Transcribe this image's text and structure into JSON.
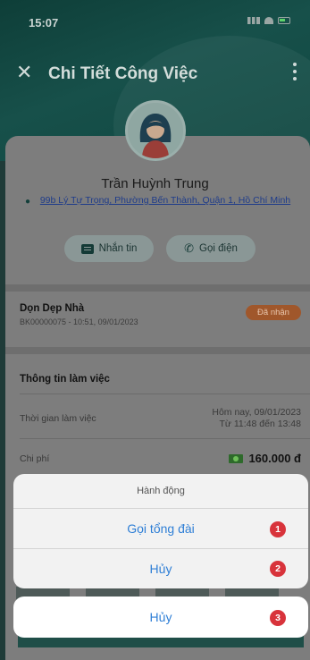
{
  "status_bar": {
    "time": "15:07"
  },
  "app_bar": {
    "title": "Chi Tiết Công Việc",
    "close_icon": "close-icon",
    "more_icon": "more-vertical-icon"
  },
  "customer": {
    "name": "Trần Huỳnh Trung",
    "address": "99b Lý Tự Trọng, Phường Bến Thành, Quận 1, Hồ Chí Minh",
    "message_label": "Nhắn tin",
    "call_label": "Gọi điện"
  },
  "job": {
    "title": "Dọn Dẹp Nhà",
    "code_time": "BK00000075 - 10:51, 09/01/2023",
    "status_badge": "Đã nhận"
  },
  "work_info": {
    "title": "Thông tin làm việc",
    "time_label": "Thời gian làm việc",
    "time_date": "Hôm nay, 09/01/2023",
    "time_range": "Từ 11:48 đến 13:48",
    "cost_label": "Chi phí",
    "cost_value": "160.000 đ"
  },
  "action_sheet": {
    "title": "Hành động",
    "call_center": "Gọi tổng đài",
    "cancel_inner": "Hủy",
    "cancel_outer": "Hủy"
  },
  "markers": [
    "1",
    "2",
    "3"
  ],
  "colors": {
    "primary": "#17504a",
    "action_blue": "#2f7fd6",
    "marker_red": "#d8333b",
    "badge": "#a0572b"
  }
}
